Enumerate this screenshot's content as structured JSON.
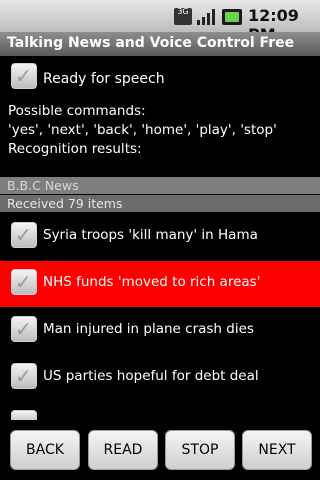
{
  "status_bar": {
    "network": "3G",
    "time": "12:09 PM",
    "icons": [
      "network-3g-icon",
      "signal-icon",
      "battery-icon"
    ]
  },
  "title": "Talking News and Voice Control Free",
  "ready": {
    "label": "Ready for speech",
    "checked": true
  },
  "info": {
    "commands_heading": "Possible commands:",
    "commands_list": "'yes', 'next', 'back', 'home', 'play', 'stop'",
    "results_heading": "Recognition results:"
  },
  "source": {
    "name": "B.B.C News",
    "count_text": "Received 79 items"
  },
  "news_items": [
    {
      "title": "Syria troops 'kill many' in Hama",
      "checked": true,
      "highlighted": false
    },
    {
      "title": "NHS funds 'moved to rich areas'",
      "checked": true,
      "highlighted": true
    },
    {
      "title": "Man injured in plane crash dies",
      "checked": true,
      "highlighted": false
    },
    {
      "title": "US parties hopeful for debt deal",
      "checked": true,
      "highlighted": false
    }
  ],
  "buttons": {
    "back": "BACK",
    "read": "READ",
    "stop": "STOP",
    "next": "NEXT"
  },
  "colors": {
    "highlight": "#ff0000",
    "background": "#000000",
    "battery": "#6ad44a"
  }
}
